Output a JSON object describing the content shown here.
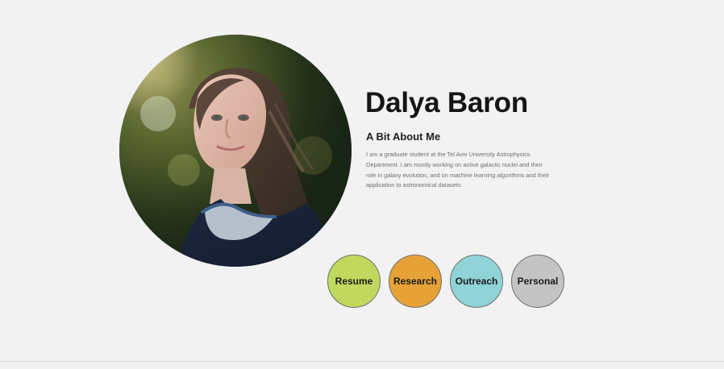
{
  "profile": {
    "name": "Dalya Baron",
    "about_heading": "A Bit About Me",
    "about_text": "I am a graduate student at the Tel Aviv University Astrophysics Department. I am mostly working on active galactic nuclei and their role in galaxy evolution, and on machine learning algorithms and their application to astronomical datasets."
  },
  "navigation": {
    "buttons": [
      {
        "label": "Resume",
        "color": "#bfd85d"
      },
      {
        "label": "Research",
        "color": "#e6a236"
      },
      {
        "label": "Outreach",
        "color": "#8fd3d6"
      },
      {
        "label": "Personal",
        "color": "#c4c4c4"
      }
    ]
  }
}
